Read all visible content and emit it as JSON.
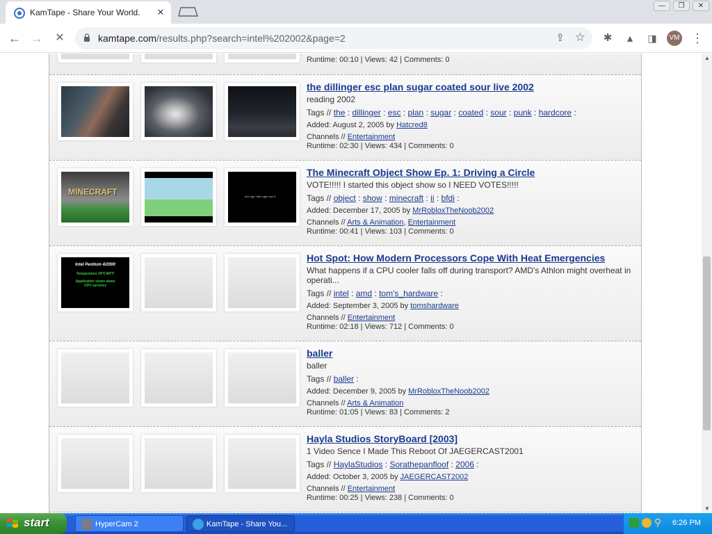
{
  "browser": {
    "tab_title": "KamTape - Share Your World.",
    "url_host": "kamtape.com",
    "url_path": "/results.php?search=intel%202002&page=2",
    "profile_initials": "VM"
  },
  "top_fragment": {
    "stats": "Runtime: 00:10 | Views: 42 | Comments: 0"
  },
  "videos": [
    {
      "title": "the dillinger esc plan sugar coated sour live 2002",
      "description": "reading 2002",
      "tags_label": "Tags //",
      "tags": [
        "the",
        "dillinger",
        "esc",
        "plan",
        "sugar",
        "coated",
        "sour",
        "punk",
        "hardcore"
      ],
      "added_text": "Added: August 2, 2005 by",
      "author": "Hatcred8",
      "channels_label": "Channels //",
      "channels": [
        "Entertainment"
      ],
      "stats": "Runtime: 02:30 | Views: 434 | Comments: 0"
    },
    {
      "title": "The Minecraft Object Show Ep. 1: Driving a Circle",
      "description": "VOTE!!!!! I started this object show so I NEED VOTES!!!!!",
      "tags_label": "Tags //",
      "tags": [
        "object",
        "show",
        "minecraft",
        "ii",
        "bfdi"
      ],
      "added_text": "Added: December 17, 2005 by",
      "author": "MrRobloxTheNoob2002",
      "channels_label": "Channels //",
      "channels": [
        "Arts & Animation",
        "Entertainment"
      ],
      "stats": "Runtime: 00:41 | Views: 103 | Comments: 0",
      "thumb1_text": "MINECRAFT",
      "thumb3_text": "uhh ugh, then ugh now it"
    },
    {
      "title": "Hot Spot: How Modern Processors Cope With Heat Emergencies",
      "description": "What happens if a CPU cooler falls off during transport? AMD's Athlon might overheat in operati...",
      "tags_label": "Tags //",
      "tags": [
        "intel",
        "amd",
        "tom's_hardware"
      ],
      "added_text": "Added: September 3, 2005 by",
      "author": "tomshardware",
      "channels_label": "Channels //",
      "channels": [
        "Entertainment"
      ],
      "stats": "Runtime: 02:18 | Views: 712 | Comments: 0",
      "thumb1_lines": [
        "Intel Pentium 4/2000",
        "Temperature 29°C/84°F",
        "Application slows down",
        "CPU services"
      ]
    },
    {
      "title": "baller",
      "description": "baller",
      "tags_label": "Tags //",
      "tags": [
        "baller"
      ],
      "added_text": "Added: December 9, 2005 by",
      "author": "MrRobloxTheNoob2002",
      "channels_label": "Channels //",
      "channels": [
        "Arts & Animation"
      ],
      "stats": "Runtime: 01:05 | Views: 83 | Comments: 2"
    },
    {
      "title": "Hayla Studios StoryBoard [2003]",
      "description": "1 Video Sence I Made This Reboot Of JAEGERCAST2001",
      "tags_label": "Tags //",
      "tags": [
        "HaylaStudios",
        "Sorathepanfloof",
        "2006"
      ],
      "added_text": "Added: October 3, 2005 by",
      "author": "JAEGERCAST2002",
      "channels_label": "Channels //",
      "channels": [
        "Entertainment"
      ],
      "stats": "Runtime: 00:25 | Views: 238 | Comments: 0"
    }
  ],
  "taskbar": {
    "start_label": "start",
    "tasks": [
      "HyperCam 2",
      "KamTape - Share You..."
    ],
    "clock": "6:26 PM"
  }
}
